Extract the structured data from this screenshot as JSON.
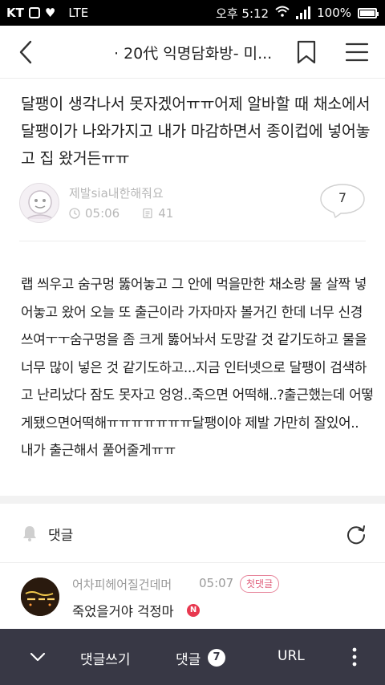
{
  "status_bar": {
    "carrier_icons": "KT",
    "network": "LTE",
    "time": "오후 5:12",
    "battery": "100%"
  },
  "header": {
    "title": "· 20代 익명담화방- 미..."
  },
  "post": {
    "title": "달팽이 생각나서 못자겠어ㅠㅠ어제 알바할 때 채소에서 달팽이가 나와가지고 내가 마감하면서 종이컵에 넣어놓고 집 왔거든ㅠㅠ",
    "author": "제발sia내한해줘요",
    "time": "05:06",
    "views": "41",
    "comment_count": "7",
    "body": "랩 씌우고 숨구멍 뚫어놓고 그 안에 먹을만한 채소랑 물 살짝 넣어놓고 왔어 오늘 또 출근이라 가자마자 볼거긴 한데 너무 신경쓰여ㅜㅜ숨구멍을 좀 크게 뚫어놔서 도망갈 것 같기도하고 물을 너무 많이 넣은 것 같기도하고...지금 인터넷으로 달팽이 검색하고 난리났다 잠도 못자고 엉엉..죽으면 어떡해..?출근했는데 어떻게됐으면어떡해ㅠㅠㅠㅠㅠㅠㅠ달팽이야 제발 가만히 잘있어.. 내가 출근해서 풀어줄게ㅠㅠ"
  },
  "comments_section": {
    "label": "댓글",
    "items": [
      {
        "author": "어차피헤어질건데머",
        "time": "05:07",
        "badge": "첫댓글",
        "text": "죽었을거야 걱정마",
        "new_marker": "N"
      }
    ]
  },
  "bottom_bar": {
    "write_label": "댓글쓰기",
    "comments_label": "댓글",
    "comments_count": "7",
    "url_label": "URL"
  },
  "colors": {
    "bottom_bar_bg": "#383845",
    "badge_pink": "#e0607c",
    "new_red": "#e8384f",
    "meta_gray": "#b8b8b8"
  }
}
